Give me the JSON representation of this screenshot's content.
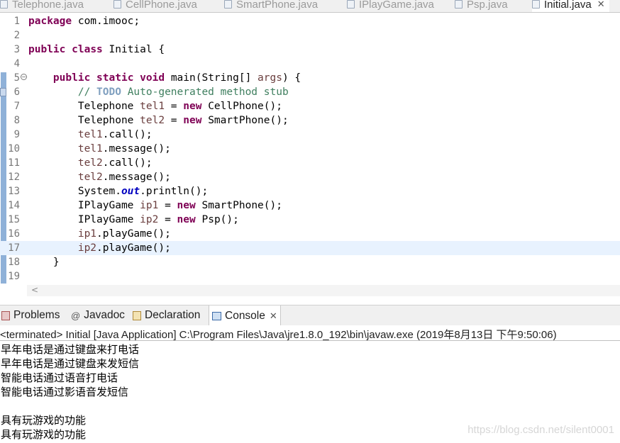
{
  "editor_tabs": [
    {
      "label": "Telephone.java",
      "active": false
    },
    {
      "label": "CellPhone.java",
      "active": false
    },
    {
      "label": "SmartPhone.java",
      "active": false
    },
    {
      "label": "IPlayGame.java",
      "active": false
    },
    {
      "label": "Psp.java",
      "active": false
    },
    {
      "label": "Initial.java",
      "active": true
    }
  ],
  "tab_close_glyph": "✕",
  "code_lines": [
    {
      "num": "1",
      "text": "package com.imooc;"
    },
    {
      "num": "2",
      "text": ""
    },
    {
      "num": "3",
      "text": "public class Initial {"
    },
    {
      "num": "4",
      "text": ""
    },
    {
      "num": "5",
      "text": "    public static void main(String[] args) {"
    },
    {
      "num": "6",
      "text": "        // TODO Auto-generated method stub"
    },
    {
      "num": "7",
      "text": "        Telephone tel1 = new CellPhone();"
    },
    {
      "num": "8",
      "text": "        Telephone tel2 = new SmartPhone();"
    },
    {
      "num": "9",
      "text": "        tel1.call();"
    },
    {
      "num": "10",
      "text": "        tel1.message();"
    },
    {
      "num": "11",
      "text": "        tel2.call();"
    },
    {
      "num": "12",
      "text": "        tel2.message();"
    },
    {
      "num": "13",
      "text": "        System.out.println();"
    },
    {
      "num": "14",
      "text": "        IPlayGame ip1 = new SmartPhone();"
    },
    {
      "num": "15",
      "text": "        IPlayGame ip2 = new Psp();"
    },
    {
      "num": "16",
      "text": "        ip1.playGame();"
    },
    {
      "num": "17",
      "text": "        ip2.playGame();"
    },
    {
      "num": "18",
      "text": "    }"
    },
    {
      "num": "19",
      "text": ""
    }
  ],
  "current_line": "17",
  "view_tabs": [
    {
      "label": "Problems",
      "icon": "problems-icon"
    },
    {
      "label": "Javadoc",
      "icon": "javadoc-icon"
    },
    {
      "label": "Declaration",
      "icon": "declaration-icon"
    },
    {
      "label": "Console",
      "icon": "console-icon",
      "active": true
    }
  ],
  "console": {
    "terminated": "<terminated> Initial [Java Application] C:\\Program Files\\Java\\jre1.8.0_192\\bin\\javaw.exe (2019年8月13日 下午9:50:06)",
    "output": [
      "早年电话是通过键盘来打电话",
      "早年电话是通过键盘来发短信",
      "智能电话通过语音打电话",
      "智能电话通过影语音发短信",
      "",
      "具有玩游戏的功能",
      "具有玩游戏的功能"
    ]
  },
  "watermark": "https://blog.csdn.net/silent0001",
  "colors": {
    "keyword": "#7f0055",
    "comment": "#3f7f5f",
    "current_line": "#e8f2fe",
    "static_field": "#0000c0"
  }
}
